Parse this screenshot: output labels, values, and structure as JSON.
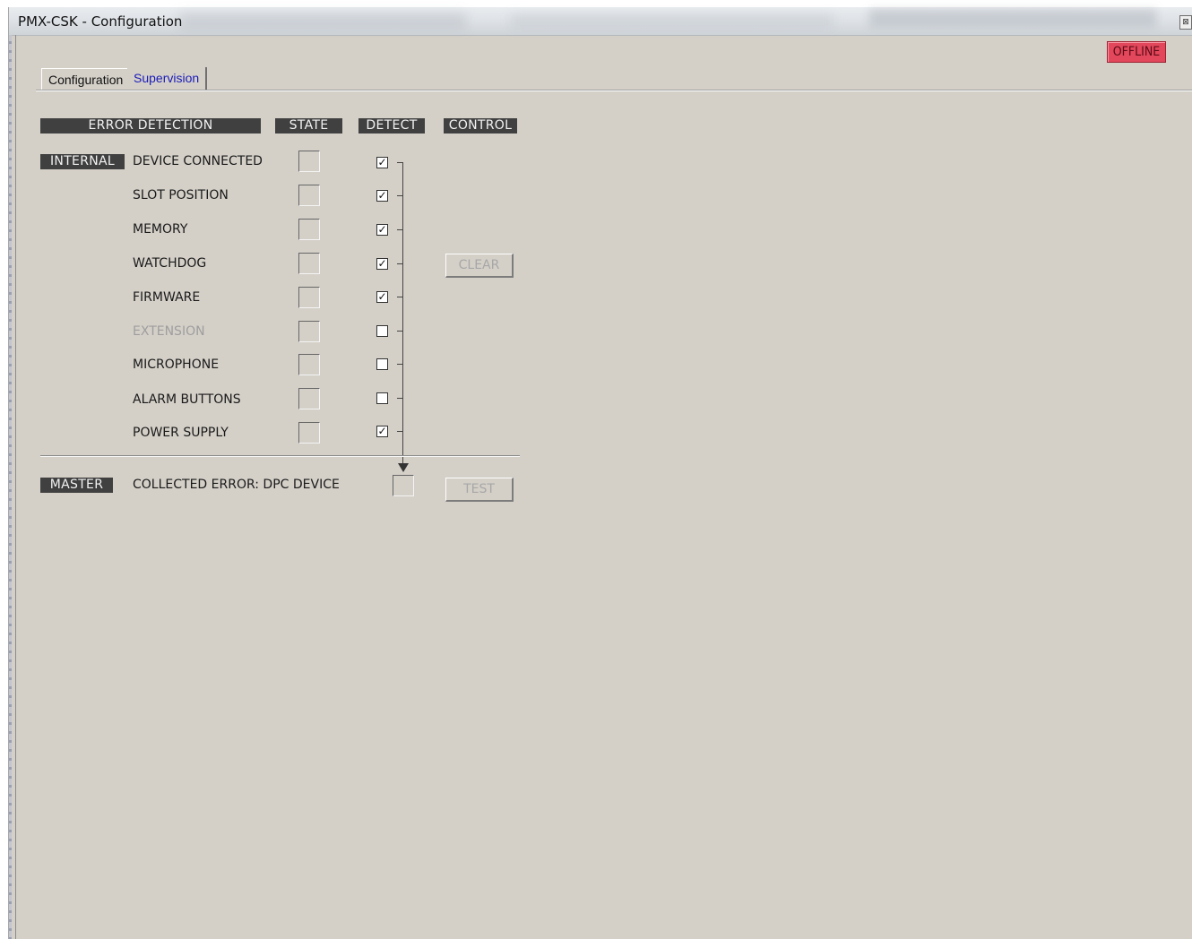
{
  "window": {
    "title": "PMX-CSK - Configuration",
    "close_glyph": "⊠"
  },
  "status": {
    "offline_label": "OFFLINE",
    "offline_color": "#e3475c"
  },
  "tabs": [
    {
      "label": "Configuration",
      "active": false
    },
    {
      "label": "Supervision",
      "active": true
    }
  ],
  "headers": {
    "error_detection": "ERROR DETECTION",
    "state": "STATE",
    "detect": "DETECT",
    "control": "CONTROL"
  },
  "groups": {
    "internal": "INTERNAL",
    "master": "MASTER"
  },
  "rows": [
    {
      "label": "DEVICE CONNECTED",
      "detect": true,
      "enabled": true
    },
    {
      "label": "SLOT POSITION",
      "detect": true,
      "enabled": true
    },
    {
      "label": "MEMORY",
      "detect": true,
      "enabled": true
    },
    {
      "label": "WATCHDOG",
      "detect": true,
      "enabled": true
    },
    {
      "label": "FIRMWARE",
      "detect": true,
      "enabled": true
    },
    {
      "label": "EXTENSION",
      "detect": false,
      "enabled": false
    },
    {
      "label": "MICROPHONE",
      "detect": false,
      "enabled": true
    },
    {
      "label": "ALARM BUTTONS",
      "detect": false,
      "enabled": true
    },
    {
      "label": "POWER SUPPLY",
      "detect": true,
      "enabled": true
    }
  ],
  "check_glyph": "✓",
  "controls": {
    "clear_label": "CLEAR",
    "test_label": "TEST"
  },
  "master": {
    "collected_label": "COLLECTED ERROR: DPC DEVICE"
  }
}
